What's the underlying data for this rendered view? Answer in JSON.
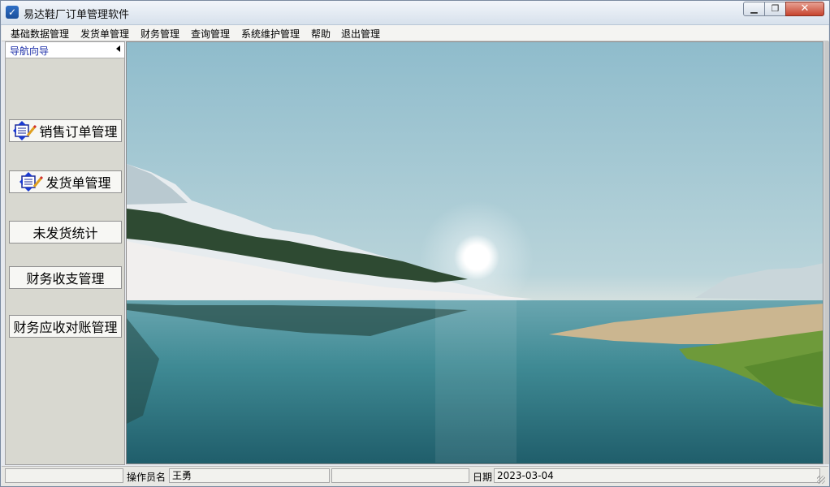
{
  "window": {
    "title": "易达鞋厂订单管理软件",
    "icon": "app-check-icon"
  },
  "menu": [
    "基础数据管理",
    "发货单管理",
    "财务管理",
    "查询管理",
    "系统维护管理",
    "帮助",
    "退出管理"
  ],
  "nav": {
    "title": "导航向导",
    "buttons": [
      {
        "label": "销售订单管理",
        "icon": "notebook-arrows-icon"
      },
      {
        "label": "发货单管理",
        "icon": "notebook-arrows-icon"
      },
      {
        "label": "未发货统计",
        "icon": ""
      },
      {
        "label": "财务收支管理",
        "icon": ""
      },
      {
        "label": "财务应收对账管理",
        "icon": ""
      }
    ]
  },
  "status": {
    "operator_label": "操作员名",
    "operator_value": "王勇",
    "date_label": "日期",
    "date_value": "2023-03-04"
  },
  "colors": {
    "nav_title": "#1c2ea8",
    "close_button": "#c7442e",
    "panel_bg": "#d8d8d0"
  }
}
